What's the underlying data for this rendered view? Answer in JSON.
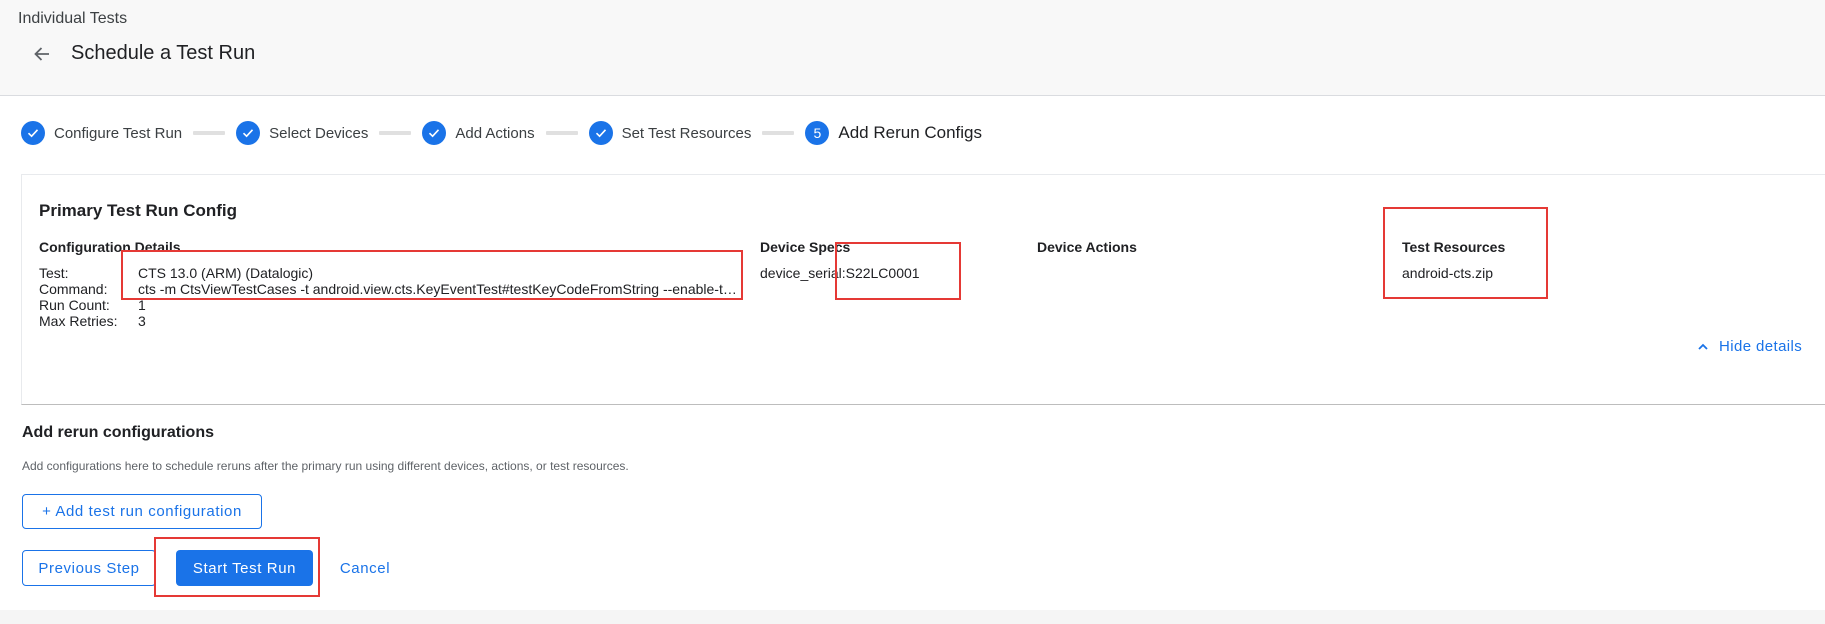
{
  "header": {
    "breadcrumb": "Individual Tests",
    "title": "Schedule a Test Run",
    "back_icon": "arrow-back-icon"
  },
  "stepper": {
    "steps": [
      {
        "label": "Configure Test Run",
        "state": "done"
      },
      {
        "label": "Select Devices",
        "state": "done"
      },
      {
        "label": "Add Actions",
        "state": "done"
      },
      {
        "label": "Set Test Resources",
        "state": "done"
      },
      {
        "label": "Add Rerun Configs",
        "state": "active",
        "number": "5"
      }
    ]
  },
  "primary_config": {
    "title": "Primary Test Run Config",
    "configuration_details": {
      "heading": "Configuration Details",
      "test_label": "Test:",
      "test_value": "CTS 13.0 (ARM) (Datalogic)",
      "command_label": "Command:",
      "command_value": "cts -m CtsViewTestCases -t android.view.cts.KeyEventTest#testKeyCodeFromString --enable-token-sharing",
      "run_count_label": "Run Count:",
      "run_count_value": "1",
      "max_retries_label": "Max Retries:",
      "max_retries_value": "3"
    },
    "device_specs": {
      "heading": "Device Specs",
      "value": "device_serial:S22LC0001"
    },
    "device_actions": {
      "heading": "Device Actions"
    },
    "test_resources": {
      "heading": "Test Resources",
      "value": "android-cts.zip"
    },
    "hide_details_label": "Hide details"
  },
  "rerun": {
    "title": "Add rerun configurations",
    "description": "Add configurations here to schedule reruns after the primary run using different devices, actions, or test resources.",
    "add_button": "+ Add test run configuration"
  },
  "actions": {
    "previous": "Previous Step",
    "start": "Start Test Run",
    "cancel": "Cancel"
  },
  "colors": {
    "accent": "#1a73e8",
    "highlight": "#e53935"
  }
}
